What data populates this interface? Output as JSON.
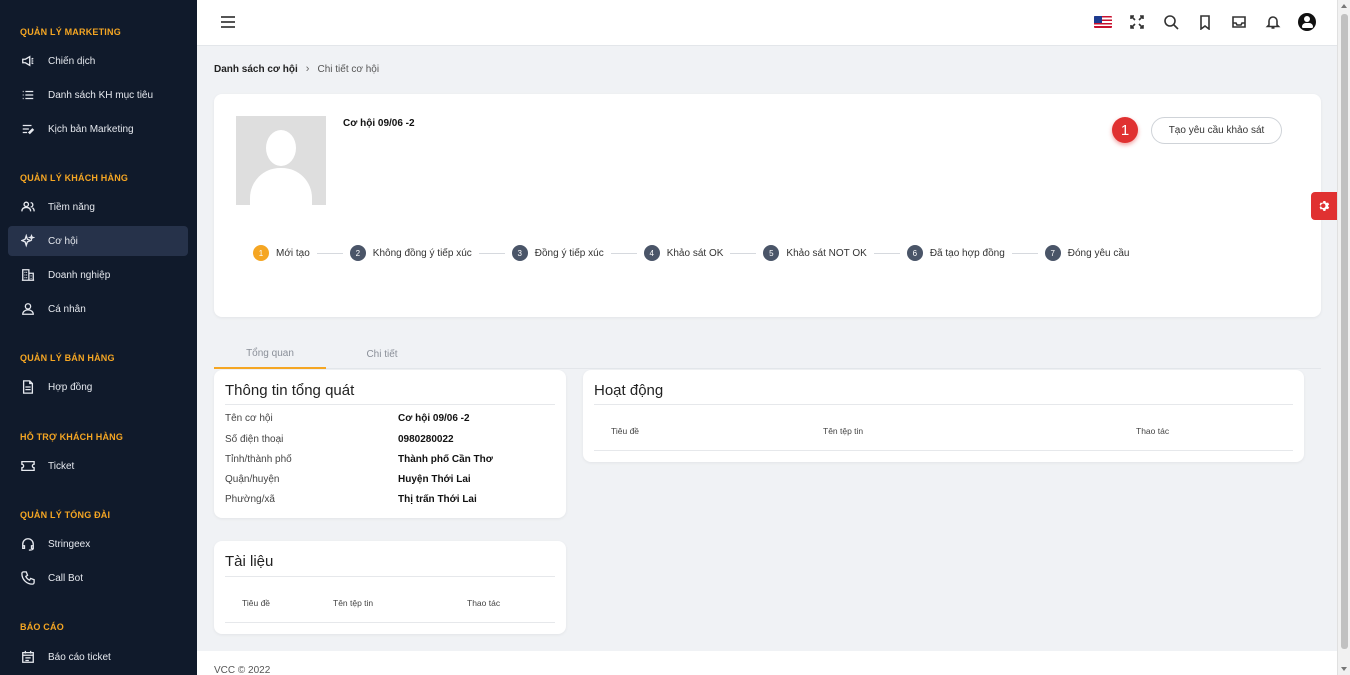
{
  "sidebar": {
    "sections": [
      {
        "title": "QUẢN LÝ MARKETING",
        "items": [
          {
            "label": "Chiến dịch",
            "icon": "megaphone-icon"
          },
          {
            "label": "Danh sách KH mục tiêu",
            "icon": "list-icon"
          },
          {
            "label": "Kịch bản Marketing",
            "icon": "script-icon"
          }
        ]
      },
      {
        "title": "QUẢN LÝ KHÁCH HÀNG",
        "items": [
          {
            "label": "Tiềm năng",
            "icon": "users-icon"
          },
          {
            "label": "Cơ hội",
            "icon": "sparkle-icon",
            "active": true
          },
          {
            "label": "Doanh nghiệp",
            "icon": "building-icon"
          },
          {
            "label": "Cá nhân",
            "icon": "user-icon"
          }
        ]
      },
      {
        "title": "QUẢN LÝ BÁN HÀNG",
        "items": [
          {
            "label": "Hợp đồng",
            "icon": "document-icon"
          }
        ]
      },
      {
        "title": "HỖ TRỢ KHÁCH HÀNG",
        "items": [
          {
            "label": "Ticket",
            "icon": "ticket-icon"
          }
        ]
      },
      {
        "title": "QUẢN LÝ TỔNG ĐÀI",
        "items": [
          {
            "label": "Stringeex",
            "icon": "headset-icon"
          },
          {
            "label": "Call Bot",
            "icon": "phone-icon"
          }
        ]
      },
      {
        "title": "BÁO CÁO",
        "items": [
          {
            "label": "Báo cáo ticket",
            "icon": "calendar-icon"
          }
        ]
      }
    ]
  },
  "topbar": {
    "icons": [
      "flag-us-icon",
      "fullscreen-icon",
      "search-icon",
      "bookmark-icon",
      "inbox-icon",
      "bell-icon",
      "user-account-icon"
    ]
  },
  "breadcrumb": {
    "parent": "Danh sách cơ hội",
    "current": "Chi tiết cơ hội"
  },
  "opportunity": {
    "name": "Cơ hội 09/06 -2",
    "badge": "1",
    "survey_button": "Tạo yêu cầu khảo sát",
    "steps": [
      {
        "num": "1",
        "label": "Mới tạo",
        "active": true
      },
      {
        "num": "2",
        "label": "Không đồng ý tiếp xúc"
      },
      {
        "num": "3",
        "label": "Đồng ý tiếp xúc"
      },
      {
        "num": "4",
        "label": "Khảo sát OK"
      },
      {
        "num": "5",
        "label": "Khảo sát NOT OK"
      },
      {
        "num": "6",
        "label": "Đã tạo hợp đồng"
      },
      {
        "num": "7",
        "label": "Đóng yêu cầu"
      }
    ]
  },
  "tabs": [
    {
      "label": "Tổng quan",
      "active": true
    },
    {
      "label": "Chi tiết"
    }
  ],
  "general_info": {
    "title": "Thông tin tổng quát",
    "rows": [
      {
        "label": "Tên cơ hội",
        "value": "Cơ hội 09/06 -2"
      },
      {
        "label": "Số điện thoại",
        "value": "0980280022"
      },
      {
        "label": "Tỉnh/thành phố",
        "value": "Thành phố Cần Thơ"
      },
      {
        "label": "Quận/huyện",
        "value": "Huyện Thới Lai"
      },
      {
        "label": "Phường/xã",
        "value": "Thị trấn Thới Lai"
      }
    ]
  },
  "documents": {
    "title": "Tài liệu",
    "columns": [
      "Tiêu đề",
      "Tên tệp tin",
      "Thao tác"
    ]
  },
  "activities": {
    "title": "Hoạt động",
    "columns": [
      "Tiêu đề",
      "Tên tệp tin",
      "Thao tác"
    ]
  },
  "footer": {
    "text": "VCC © 2022"
  },
  "colors": {
    "sidebar_bg": "#101a2b",
    "accent": "#f5a623",
    "badge": "#e03131"
  }
}
